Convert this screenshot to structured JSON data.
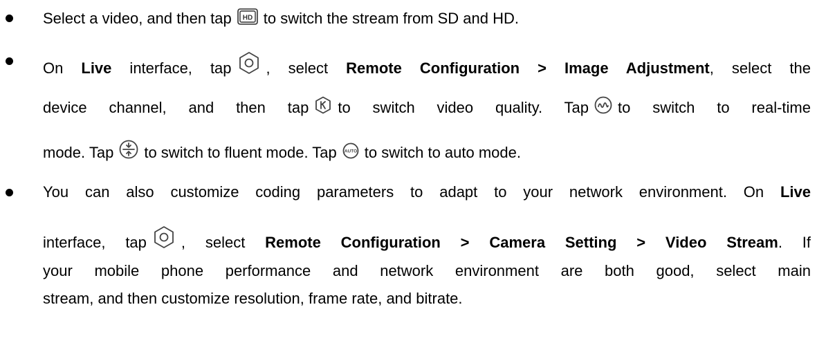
{
  "bullets": [
    {
      "lines": [
        {
          "parts": [
            {
              "t": "Select a video, and then tap"
            },
            {
              "icon": "hd-icon"
            },
            {
              "t": "to switch the stream from SD and HD."
            }
          ]
        }
      ]
    },
    {
      "lines": [
        {
          "justify": true,
          "parts": [
            {
              "t": "On "
            },
            {
              "b": "Live"
            },
            {
              "t": " interface, tap"
            },
            {
              "icon": "settings-hexagon-icon"
            },
            {
              "t": ", select "
            },
            {
              "b": "Remote Configuration > Image Adjustment"
            },
            {
              "t": ", select the"
            }
          ]
        },
        {
          "justify": true,
          "parts": [
            {
              "t": "device channel, and then tap"
            },
            {
              "icon": "video-quality-icon"
            },
            {
              "t": "to switch video quality. Tap"
            },
            {
              "icon": "real-time-mode-icon"
            },
            {
              "t": "to switch to real-time"
            }
          ]
        },
        {
          "parts": [
            {
              "t": "mode. Tap"
            },
            {
              "icon": "fluent-mode-icon"
            },
            {
              "t": "to switch to fluent mode. Tap"
            },
            {
              "icon": "auto-mode-icon"
            },
            {
              "t": "to switch to auto mode."
            }
          ]
        }
      ]
    },
    {
      "lines": [
        {
          "justify": true,
          "parts": [
            {
              "t": "You can also customize coding parameters to adapt to your network environment. On "
            },
            {
              "b": "Live"
            }
          ]
        },
        {
          "justify": true,
          "parts": [
            {
              "t": "interface, tap"
            },
            {
              "icon": "settings-hexagon-icon"
            },
            {
              "t": ", select "
            },
            {
              "b": "Remote Configuration > Camera Setting > Video Stream"
            },
            {
              "t": ". If"
            }
          ]
        },
        {
          "justify": true,
          "parts": [
            {
              "t": "your mobile phone performance and network environment are both good, select main"
            }
          ]
        },
        {
          "parts": [
            {
              "t": "stream, and then customize resolution, frame rate, and bitrate."
            }
          ]
        }
      ]
    }
  ],
  "icons": {
    "hd-icon": {
      "label": "HD"
    },
    "auto-mode-icon": {
      "label": "AUTO"
    }
  }
}
